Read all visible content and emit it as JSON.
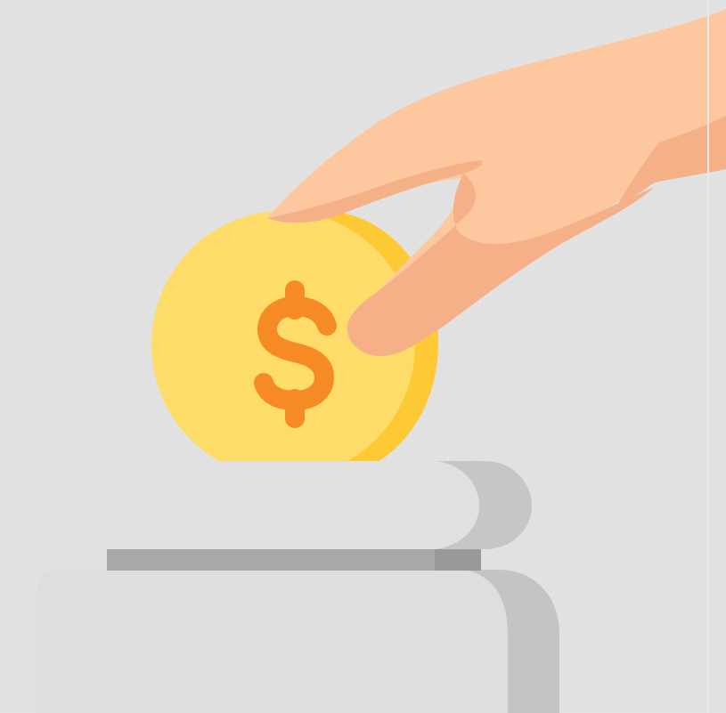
{
  "illustration": {
    "subject": "hand-inserting-coin-into-jar",
    "coin_symbol": "$",
    "colors": {
      "background": "#e2e2e2",
      "background_speckle": "#d6d6d6",
      "coin_face": "#fedc6a",
      "coin_edge": "#fdc935",
      "dollar_sign": "#f68a24",
      "hand_skin": "#fdc8a0",
      "hand_shadow": "#f5b087",
      "jar_lid": "#e0e0e0",
      "jar_lid_shadow": "#c6c6c6",
      "jar_slot": "#a8a8a8",
      "jar_slot_dark": "#999999",
      "jar_body": "#dedede",
      "jar_body_shadow": "#c4c4c4"
    }
  }
}
